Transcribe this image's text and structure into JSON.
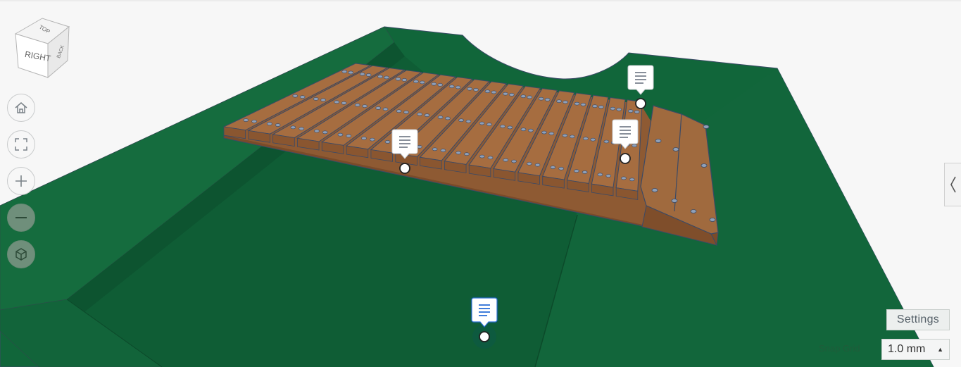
{
  "view_cube": {
    "front_face_label": "RIGHT",
    "top_face_label": "TOP",
    "side_face_label": "BACK"
  },
  "view_controls": [
    {
      "name": "home-view-button",
      "icon": "home-icon"
    },
    {
      "name": "fit-all-button",
      "icon": "fit-frame-icon"
    },
    {
      "name": "zoom-in-button",
      "icon": "plus-icon"
    },
    {
      "name": "zoom-out-button",
      "icon": "minus-icon"
    },
    {
      "name": "perspective-toggle-button",
      "icon": "cube-icon"
    }
  ],
  "bottom_right": {
    "settings_label": "Settings",
    "snap_grid_label": "Snap Grid",
    "snap_grid_value": "1.0 mm"
  },
  "side_panel": {
    "toggle_icon": "chevron-left-icon"
  },
  "colors": {
    "ground": "#11663a",
    "ground_shadow": "#0e5631",
    "wood_top": "#a66d40",
    "wood_front": "#8a5630",
    "bar_edge": "#3b4a66",
    "active_note": "#2b6fd6"
  }
}
